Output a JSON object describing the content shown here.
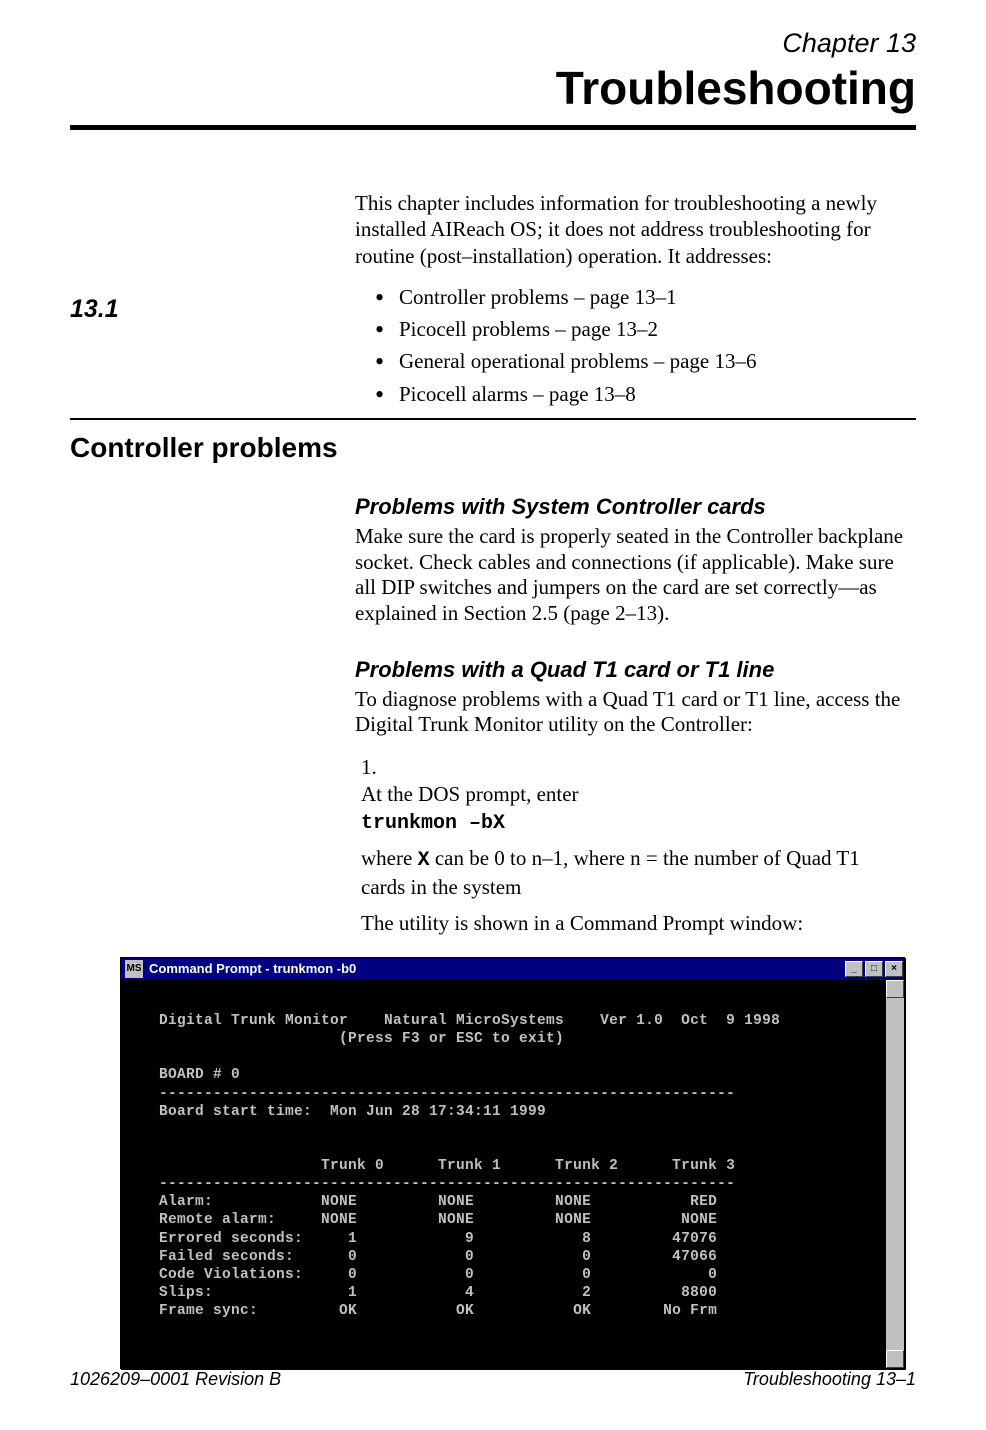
{
  "chapter": {
    "label": "Chapter 13",
    "title": "Troubleshooting"
  },
  "intro": "This chapter includes information for troubleshooting a newly installed AIReach OS; it does not address troubleshooting for routine (post–installation) operation. It addresses:",
  "bullets": [
    "Controller problems – page 13–1",
    "Picocell problems – page 13–2",
    "General operational problems – page 13–6",
    "Picocell alarms – page 13–8"
  ],
  "section": {
    "number": "13.1",
    "title": "Controller problems"
  },
  "sub1": {
    "title": "Problems with System Controller cards",
    "body": "Make sure the card is properly seated in the Controller backplane socket. Check cables and connections (if applicable). Make sure all DIP switches and jumpers on the card are set correctly—as explained in Section 2.5 (page 2–13)."
  },
  "sub2": {
    "title": "Problems with a Quad T1 card or T1 line",
    "body": "To diagnose problems with a Quad T1 card or T1 line, access the Digital Trunk Monitor utility on the Controller:"
  },
  "step1": {
    "num": "1.",
    "line1": "At the DOS prompt, enter",
    "code": "trunkmon –bX",
    "line2a": "where ",
    "line2code": "X",
    "line2b": " can be 0 to n–1, where n = the number of Quad T1 cards in the system",
    "line3": "The utility is shown in a Command Prompt window:"
  },
  "cmdwin": {
    "title": "Command Prompt - trunkmon -b0",
    "content": "\nDigital Trunk Monitor    Natural MicroSystems    Ver 1.0  Oct  9 1998\n                    (Press F3 or ESC to exit)\n\nBOARD # 0\n----------------------------------------------------------------\nBoard start time:  Mon Jun 28 17:34:11 1999\n\n\n                  Trunk 0      Trunk 1      Trunk 2      Trunk 3\n----------------------------------------------------------------\nAlarm:            NONE         NONE         NONE           RED\nRemote alarm:     NONE         NONE         NONE          NONE\nErrored seconds:     1            9            8         47076\nFailed seconds:      0            0            0         47066\nCode Violations:     0            0            0             0\nSlips:               1            4            2          8800\nFrame sync:         OK           OK           OK        No Frm\n\n"
  },
  "footer": {
    "left": "1026209–0001  Revision B",
    "right": "Troubleshooting   13–1"
  }
}
